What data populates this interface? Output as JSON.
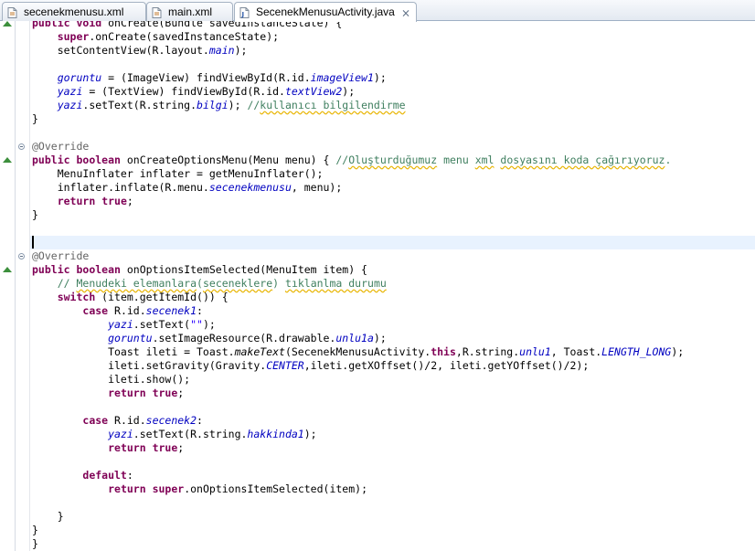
{
  "tabs": [
    {
      "label": "secenekmenusu.xml",
      "icon": "xml-file-icon",
      "active": false
    },
    {
      "label": "main.xml",
      "icon": "xml-file-icon",
      "active": false
    },
    {
      "label": "SecenekMenusuActivity.java",
      "icon": "java-file-icon",
      "active": true,
      "close": "⨯"
    }
  ],
  "editor": {
    "current_line_index": 16,
    "lines": [
      [
        [
          "kw",
          "public"
        ],
        [
          "t",
          " "
        ],
        [
          "kw",
          "void"
        ],
        [
          "t",
          " onCreate(Bundle savedInstanceState) {"
        ]
      ],
      [
        [
          "t",
          "    "
        ],
        [
          "kw",
          "super"
        ],
        [
          "t",
          ".onCreate(savedInstanceState);"
        ]
      ],
      [
        [
          "t",
          "    setContentView(R.layout."
        ],
        [
          "fd",
          "main"
        ],
        [
          "t",
          ");"
        ]
      ],
      [
        [
          "t",
          ""
        ]
      ],
      [
        [
          "t",
          "    "
        ],
        [
          "fd",
          "goruntu"
        ],
        [
          "t",
          " = (ImageView) findViewById(R.id."
        ],
        [
          "fd",
          "imageView1"
        ],
        [
          "t",
          ");"
        ]
      ],
      [
        [
          "t",
          "    "
        ],
        [
          "fd",
          "yazi"
        ],
        [
          "t",
          " = (TextView) findViewById(R.id."
        ],
        [
          "fd",
          "textView2"
        ],
        [
          "t",
          ");"
        ]
      ],
      [
        [
          "t",
          "    "
        ],
        [
          "fd",
          "yazi"
        ],
        [
          "t",
          ".setText(R.string."
        ],
        [
          "fd",
          "bilgi"
        ],
        [
          "t",
          "); "
        ],
        [
          "cm",
          "//"
        ],
        [
          "cmsq",
          "kullanıcı bilgilendirme"
        ]
      ],
      [
        [
          "t",
          "}"
        ]
      ],
      [
        [
          "t",
          ""
        ]
      ],
      [
        [
          "an",
          "@Override"
        ]
      ],
      [
        [
          "kw",
          "public"
        ],
        [
          "t",
          " "
        ],
        [
          "kw",
          "boolean"
        ],
        [
          "t",
          " onCreateOptionsMenu(Menu menu) { "
        ],
        [
          "cm",
          "//"
        ],
        [
          "cmsq",
          "Oluşturduğumuz"
        ],
        [
          "cm",
          " menu "
        ],
        [
          "cmsq",
          "xml"
        ],
        [
          "cm",
          " "
        ],
        [
          "cmsq",
          "dosyasını koda çağırıyoruz"
        ],
        [
          "cm",
          "."
        ]
      ],
      [
        [
          "t",
          "    MenuInflater inflater = getMenuInflater();"
        ]
      ],
      [
        [
          "t",
          "    inflater.inflate(R.menu."
        ],
        [
          "fd",
          "secenekmenusu"
        ],
        [
          "t",
          ", menu);"
        ]
      ],
      [
        [
          "t",
          "    "
        ],
        [
          "kw",
          "return"
        ],
        [
          "t",
          " "
        ],
        [
          "kw",
          "true"
        ],
        [
          "t",
          ";"
        ]
      ],
      [
        [
          "t",
          "}"
        ]
      ],
      [
        [
          "t",
          ""
        ]
      ],
      [
        [
          "t",
          ""
        ]
      ],
      [
        [
          "an",
          "@Override"
        ]
      ],
      [
        [
          "kw",
          "public"
        ],
        [
          "t",
          " "
        ],
        [
          "kw",
          "boolean"
        ],
        [
          "t",
          " onOptionsItemSelected(MenuItem item) {"
        ]
      ],
      [
        [
          "t",
          "    "
        ],
        [
          "cm",
          "// "
        ],
        [
          "cmsq",
          "Menudeki elemanlara"
        ],
        [
          "cm",
          "("
        ],
        [
          "cmsq",
          "seceneklere"
        ],
        [
          "cm",
          ") "
        ],
        [
          "cmsq",
          "tıklanlma durumu"
        ]
      ],
      [
        [
          "t",
          "    "
        ],
        [
          "kw",
          "switch"
        ],
        [
          "t",
          " (item.getItemId()) {"
        ]
      ],
      [
        [
          "t",
          "        "
        ],
        [
          "kw",
          "case"
        ],
        [
          "t",
          " R.id."
        ],
        [
          "fd",
          "secenek1"
        ],
        [
          "t",
          ":"
        ]
      ],
      [
        [
          "t",
          "            "
        ],
        [
          "fd",
          "yazi"
        ],
        [
          "t",
          ".setText("
        ],
        [
          "st",
          "\"\""
        ],
        [
          "t",
          ");"
        ]
      ],
      [
        [
          "t",
          "            "
        ],
        [
          "fd",
          "goruntu"
        ],
        [
          "t",
          ".setImageResource(R.drawable."
        ],
        [
          "fd",
          "unlu1a"
        ],
        [
          "t",
          ");"
        ]
      ],
      [
        [
          "t",
          "            Toast ileti = Toast."
        ],
        [
          "it",
          "makeText"
        ],
        [
          "t",
          "(SecenekMenusuActivity."
        ],
        [
          "kw",
          "this"
        ],
        [
          "t",
          ",R.string."
        ],
        [
          "fd",
          "unlu1"
        ],
        [
          "t",
          ", Toast."
        ],
        [
          "fd",
          "LENGTH_LONG"
        ],
        [
          "t",
          ");"
        ]
      ],
      [
        [
          "t",
          "            ileti.setGravity(Gravity."
        ],
        [
          "fd",
          "CENTER"
        ],
        [
          "t",
          ",ileti.getXOffset()/2, ileti.getYOffset()/2);"
        ]
      ],
      [
        [
          "t",
          "            ileti.show();"
        ]
      ],
      [
        [
          "t",
          "            "
        ],
        [
          "kw",
          "return"
        ],
        [
          "t",
          " "
        ],
        [
          "kw",
          "true"
        ],
        [
          "t",
          ";"
        ]
      ],
      [
        [
          "t",
          ""
        ]
      ],
      [
        [
          "t",
          "        "
        ],
        [
          "kw",
          "case"
        ],
        [
          "t",
          " R.id."
        ],
        [
          "fd",
          "secenek2"
        ],
        [
          "t",
          ":"
        ]
      ],
      [
        [
          "t",
          "            "
        ],
        [
          "fd",
          "yazi"
        ],
        [
          "t",
          ".setText(R.string."
        ],
        [
          "fd",
          "hakkinda1"
        ],
        [
          "t",
          ");"
        ]
      ],
      [
        [
          "t",
          "            "
        ],
        [
          "kw",
          "return"
        ],
        [
          "t",
          " "
        ],
        [
          "kw",
          "true"
        ],
        [
          "t",
          ";"
        ]
      ],
      [
        [
          "t",
          ""
        ]
      ],
      [
        [
          "t",
          "        "
        ],
        [
          "kw",
          "default"
        ],
        [
          "t",
          ":"
        ]
      ],
      [
        [
          "t",
          "            "
        ],
        [
          "kw",
          "return"
        ],
        [
          "t",
          " "
        ],
        [
          "kw",
          "super"
        ],
        [
          "t",
          ".onOptionsItemSelected(item);"
        ]
      ],
      [
        [
          "t",
          ""
        ]
      ],
      [
        [
          "t",
          "    }"
        ]
      ],
      [
        [
          "t",
          "}"
        ]
      ],
      [
        [
          "t",
          "}"
        ]
      ]
    ],
    "fold_markers": [
      9,
      17
    ],
    "override_markers": [
      10,
      18
    ]
  }
}
